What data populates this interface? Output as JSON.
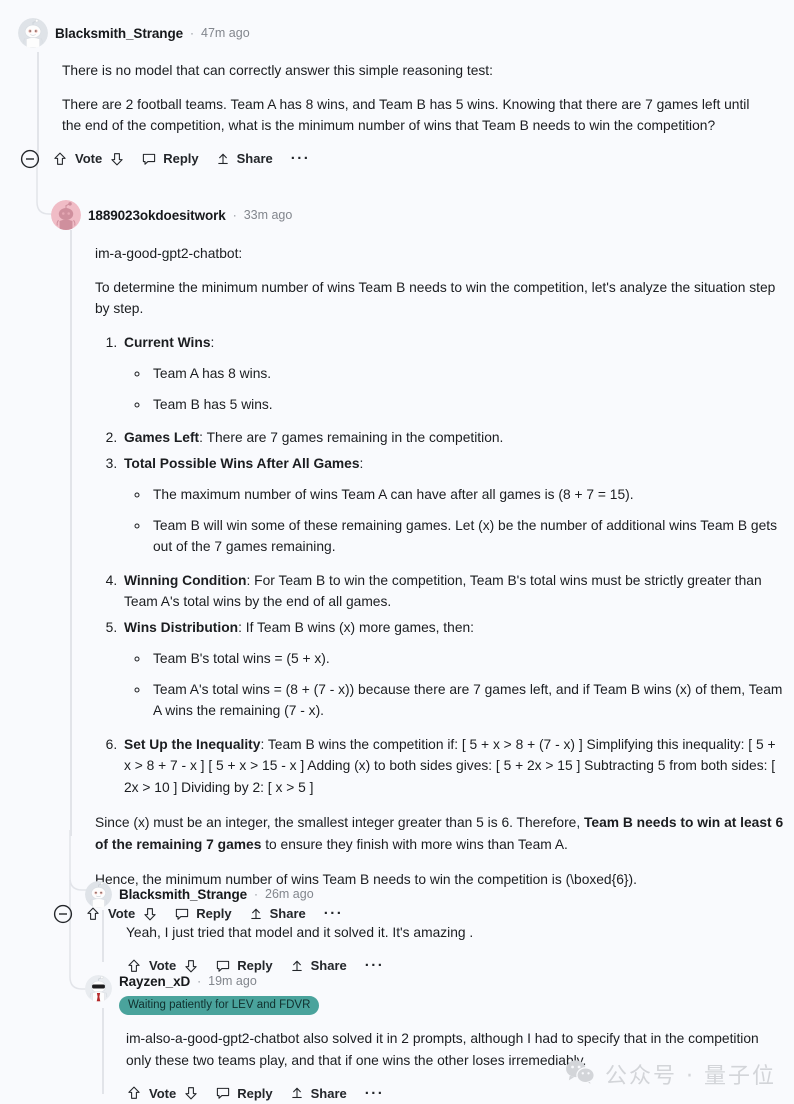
{
  "theme": {
    "background": "#f9fafd",
    "text": "#1b1d20",
    "muted": "#82868d",
    "rail": "#e2e4e9",
    "flair_bg": "#4aa39c",
    "flair_text": "#10302e",
    "watermark": "#d3d5d9"
  },
  "actions": {
    "collapse": "collapse-toggle",
    "vote": "Vote",
    "reply": "Reply",
    "share": "Share",
    "more": "···"
  },
  "comments": [
    {
      "id": "c1",
      "author": "Blacksmith_Strange",
      "separator": "·",
      "timestamp": "47m ago",
      "avatar": "snoo-default-avatar",
      "paragraphs": [
        "There is no model that can correctly answer this simple reasoning test:",
        "There are 2 football teams. Team A has 8 wins, and Team B has 5 wins. Knowing that there are 7 games left until the end of the competition, what is the minimum number of wins that Team B needs to win the competition?"
      ]
    },
    {
      "id": "c2",
      "author": "1889023okdoesitwork",
      "separator": "·",
      "timestamp": "33m ago",
      "avatar": "snoo-pink-avatar",
      "intro": "im-a-good-gpt2-chatbot:",
      "lead": "To determine the minimum number of wins Team B needs to win the competition, let's analyze the situation step by step.",
      "steps": [
        {
          "label": "Current Wins",
          "label_suffix": ":",
          "rest": "",
          "subitems": [
            "Team A has 8 wins.",
            "Team B has 5 wins."
          ]
        },
        {
          "label": "Games Left",
          "label_suffix": ":",
          "rest": " There are 7 games remaining in the competition.",
          "subitems": []
        },
        {
          "label": "Total Possible Wins After All Games",
          "label_suffix": ":",
          "rest": "",
          "subitems": [
            "The maximum number of wins Team A can have after all games is (8 + 7 = 15).",
            "Team B will win some of these remaining games. Let (x) be the number of additional wins Team B gets out of the 7 games remaining."
          ]
        },
        {
          "label": "Winning Condition",
          "label_suffix": ":",
          "rest": " For Team B to win the competition, Team B's total wins must be strictly greater than Team A's total wins by the end of all games.",
          "subitems": []
        },
        {
          "label": "Wins Distribution",
          "label_suffix": ":",
          "rest": " If Team B wins (x) more games, then:",
          "subitems": [
            "Team B's total wins = (5 + x).",
            "Team A's total wins = (8 + (7 - x)) because there are 7 games left, and if Team B wins (x) of them, Team A wins the remaining (7 - x)."
          ]
        },
        {
          "label": "Set Up the Inequality",
          "label_suffix": ":",
          "rest": " Team B wins the competition if: [ 5 + x > 8 + (7 - x) ] Simplifying this inequality: [ 5 + x > 8 + 7 - x ] [ 5 + x > 15 - x ] Adding (x) to both sides gives: [ 5 + 2x > 15 ] Subtracting 5 from both sides: [ 2x > 10 ] Dividing by 2: [ x > 5 ]",
          "subitems": []
        }
      ],
      "conclusion_pre": "Since (x) must be an integer, the smallest integer greater than 5 is 6. Therefore, ",
      "conclusion_bold": "Team B needs to win at least 6 of the remaining 7 games",
      "conclusion_post": " to ensure they finish with more wins than Team A.",
      "final": "Hence, the minimum number of wins Team B needs to win the competition is (\\boxed{6})."
    },
    {
      "id": "c3",
      "author": "Blacksmith_Strange",
      "separator": "·",
      "timestamp": "26m ago",
      "avatar": "snoo-default-avatar",
      "paragraphs": [
        "Yeah, I just tried that model and it solved it. It's amazing ."
      ]
    },
    {
      "id": "c4",
      "author": "Rayzen_xD",
      "separator": "·",
      "timestamp": "19m ago",
      "avatar": "snoo-sunglasses-avatar",
      "flair": "Waiting patiently for LEV and FDVR",
      "paragraphs": [
        "im-also-a-good-gpt2-chatbot also solved it in 2 prompts, although I had to specify that in the competition only these two teams play, and that if one wins the other loses irremediably."
      ]
    }
  ],
  "watermark": {
    "icon": "wechat-icon",
    "text": "公众号 · 量子位"
  }
}
